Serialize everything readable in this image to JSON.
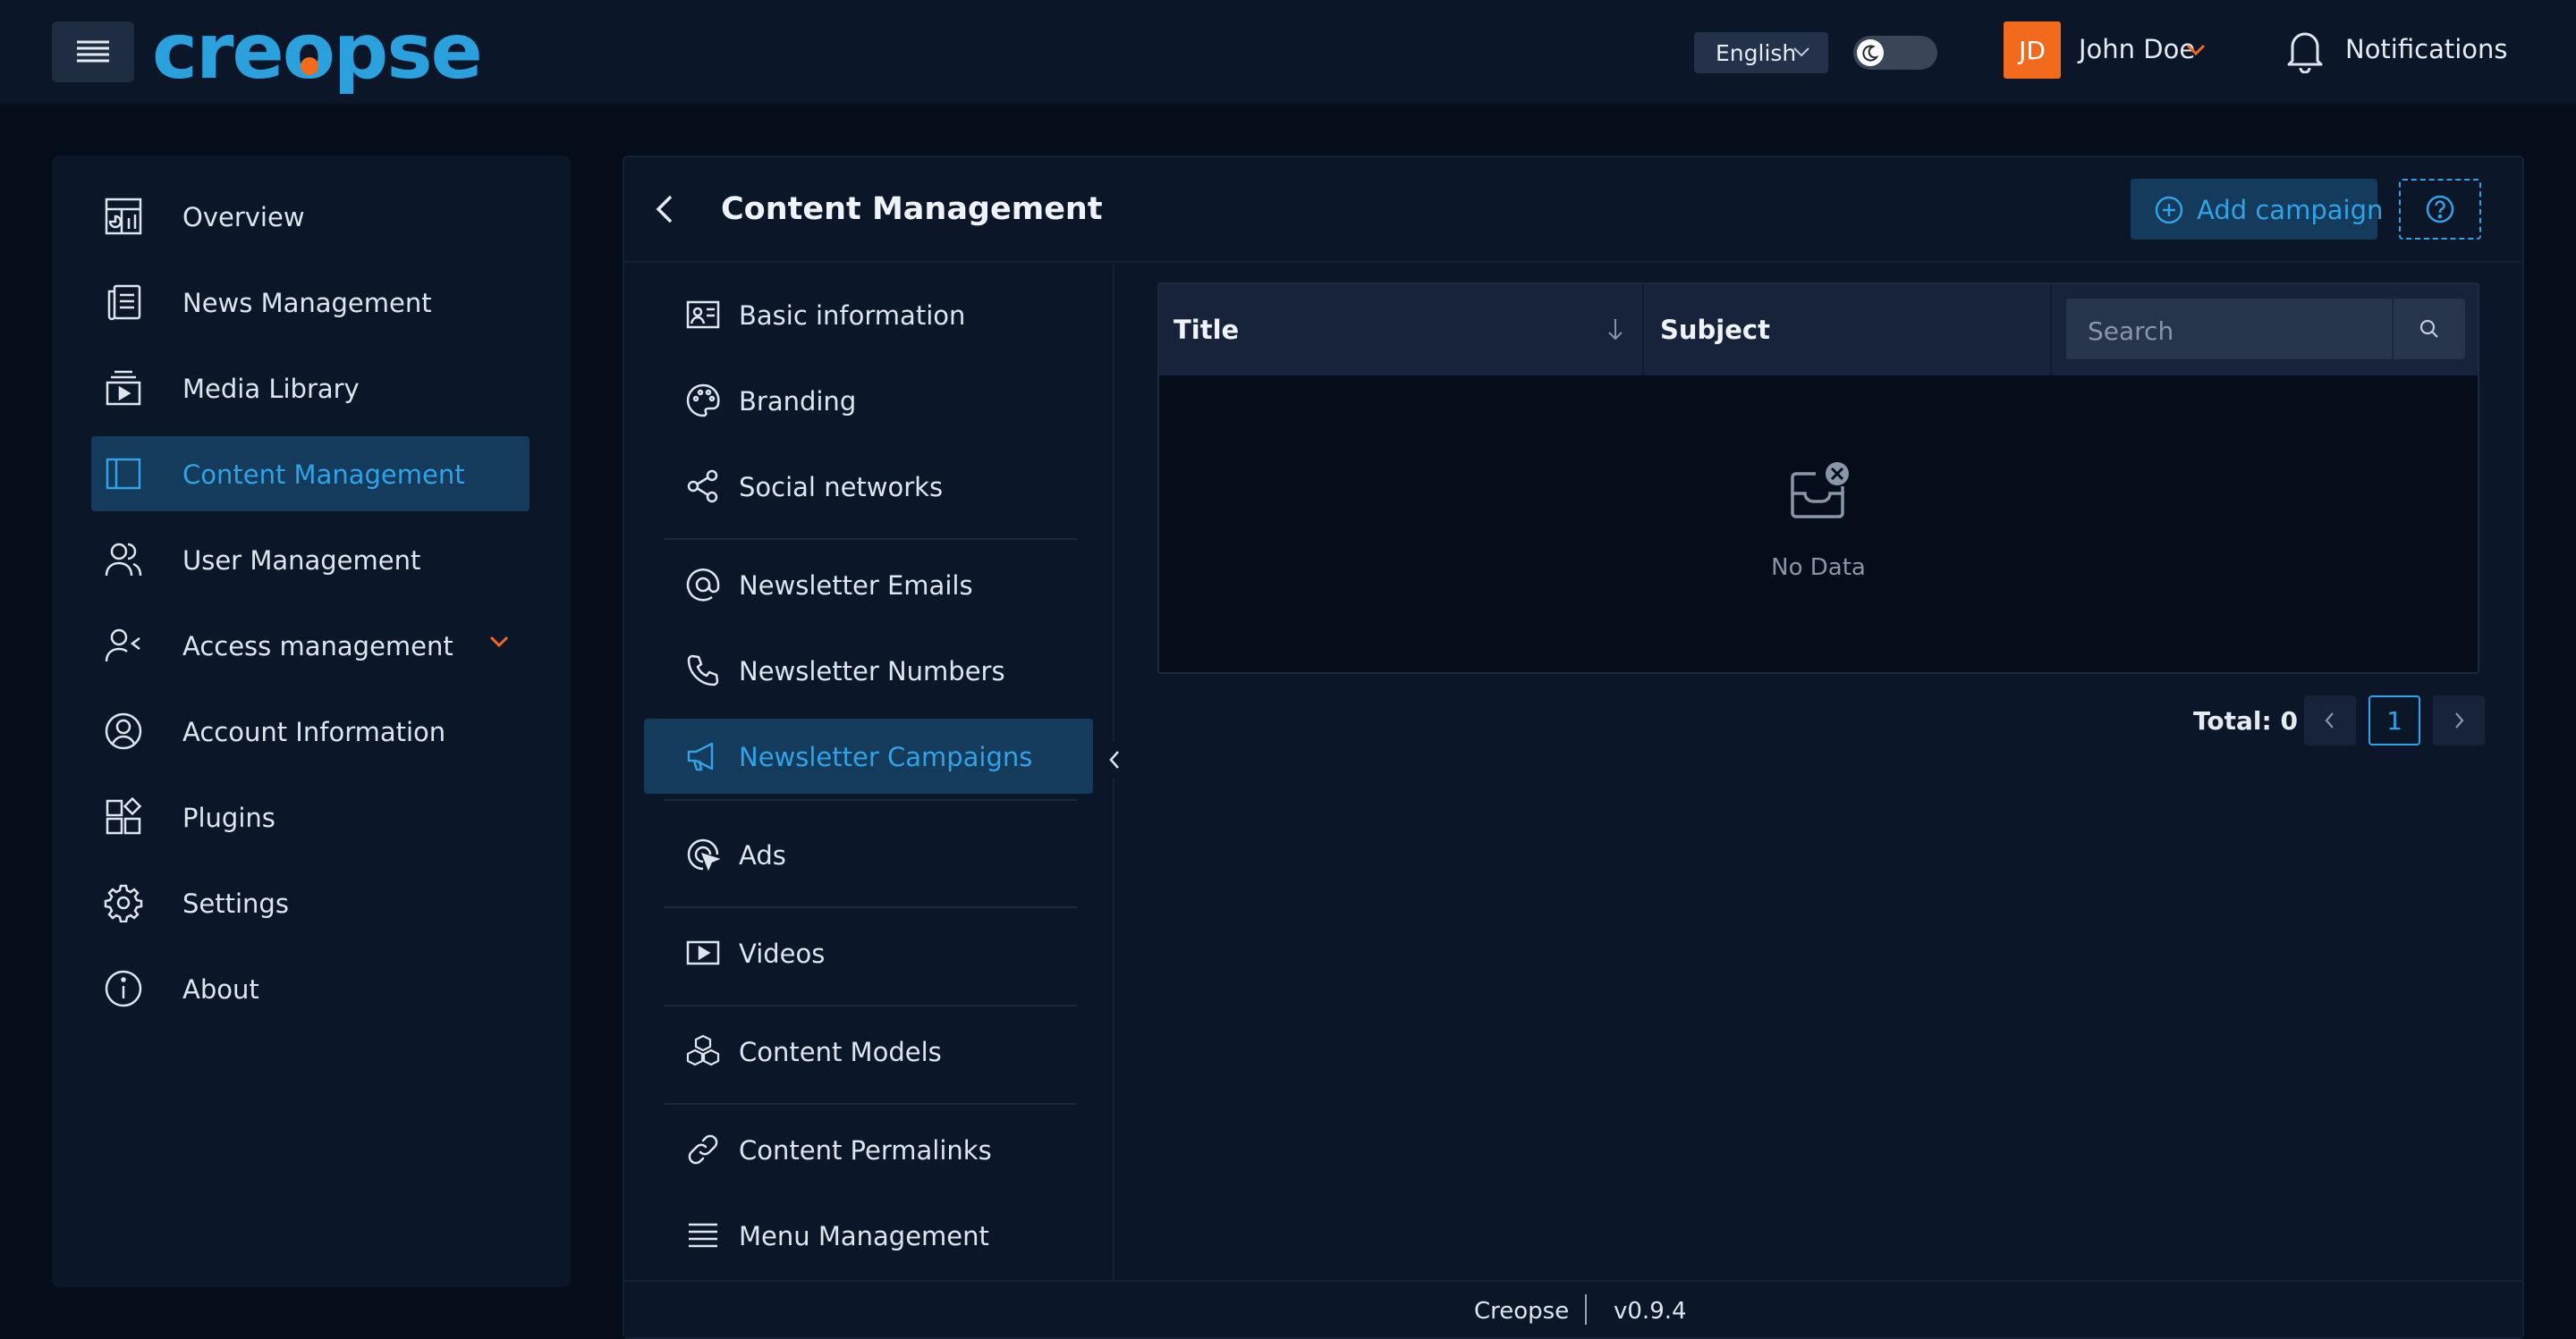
{
  "header": {
    "logo_text": "creopse",
    "language": "English",
    "avatar_initials": "JD",
    "user_name": "John Doe",
    "notifications_label": "Notifications"
  },
  "sidebar": {
    "items": [
      {
        "label": "Overview",
        "icon": "overview-icon"
      },
      {
        "label": "News Management",
        "icon": "news-icon"
      },
      {
        "label": "Media Library",
        "icon": "media-library-icon"
      },
      {
        "label": "Content Management",
        "icon": "content-management-icon",
        "active": true
      },
      {
        "label": "User Management",
        "icon": "users-icon"
      },
      {
        "label": "Access management",
        "icon": "access-icon",
        "expandable": true
      },
      {
        "label": "Account Information",
        "icon": "account-icon"
      },
      {
        "label": "Plugins",
        "icon": "plugins-icon"
      },
      {
        "label": "Settings",
        "icon": "settings-icon"
      },
      {
        "label": "About",
        "icon": "info-icon"
      }
    ]
  },
  "main": {
    "title": "Content Management",
    "add_button": "Add campaign"
  },
  "submenu": {
    "items": [
      {
        "label": "Basic information",
        "icon": "id-card-icon"
      },
      {
        "label": "Branding",
        "icon": "palette-icon"
      },
      {
        "label": "Social networks",
        "icon": "share-icon"
      },
      {
        "label": "Newsletter Emails",
        "icon": "at-sign-icon"
      },
      {
        "label": "Newsletter Numbers",
        "icon": "phone-icon"
      },
      {
        "label": "Newsletter Campaigns",
        "icon": "megaphone-icon",
        "active": true
      },
      {
        "label": "Ads",
        "icon": "ads-icon"
      },
      {
        "label": "Videos",
        "icon": "video-icon"
      },
      {
        "label": "Content Models",
        "icon": "cubes-icon"
      },
      {
        "label": "Content Permalinks",
        "icon": "link-icon"
      },
      {
        "label": "Menu Management",
        "icon": "menu-lines-icon"
      }
    ]
  },
  "table": {
    "columns": [
      "Title",
      "Subject"
    ],
    "search_placeholder": "Search",
    "empty_text": "No Data"
  },
  "pagination": {
    "total_label": "Total: 0",
    "current_page": "1"
  },
  "footer": {
    "app_name": "Creopse",
    "version": "v0.9.4"
  },
  "colors": {
    "accent": "#2fa3e6",
    "brand": "#2aa0dc",
    "orange": "#f26a1b",
    "background": "#060d1a",
    "panel": "#0b1628"
  }
}
